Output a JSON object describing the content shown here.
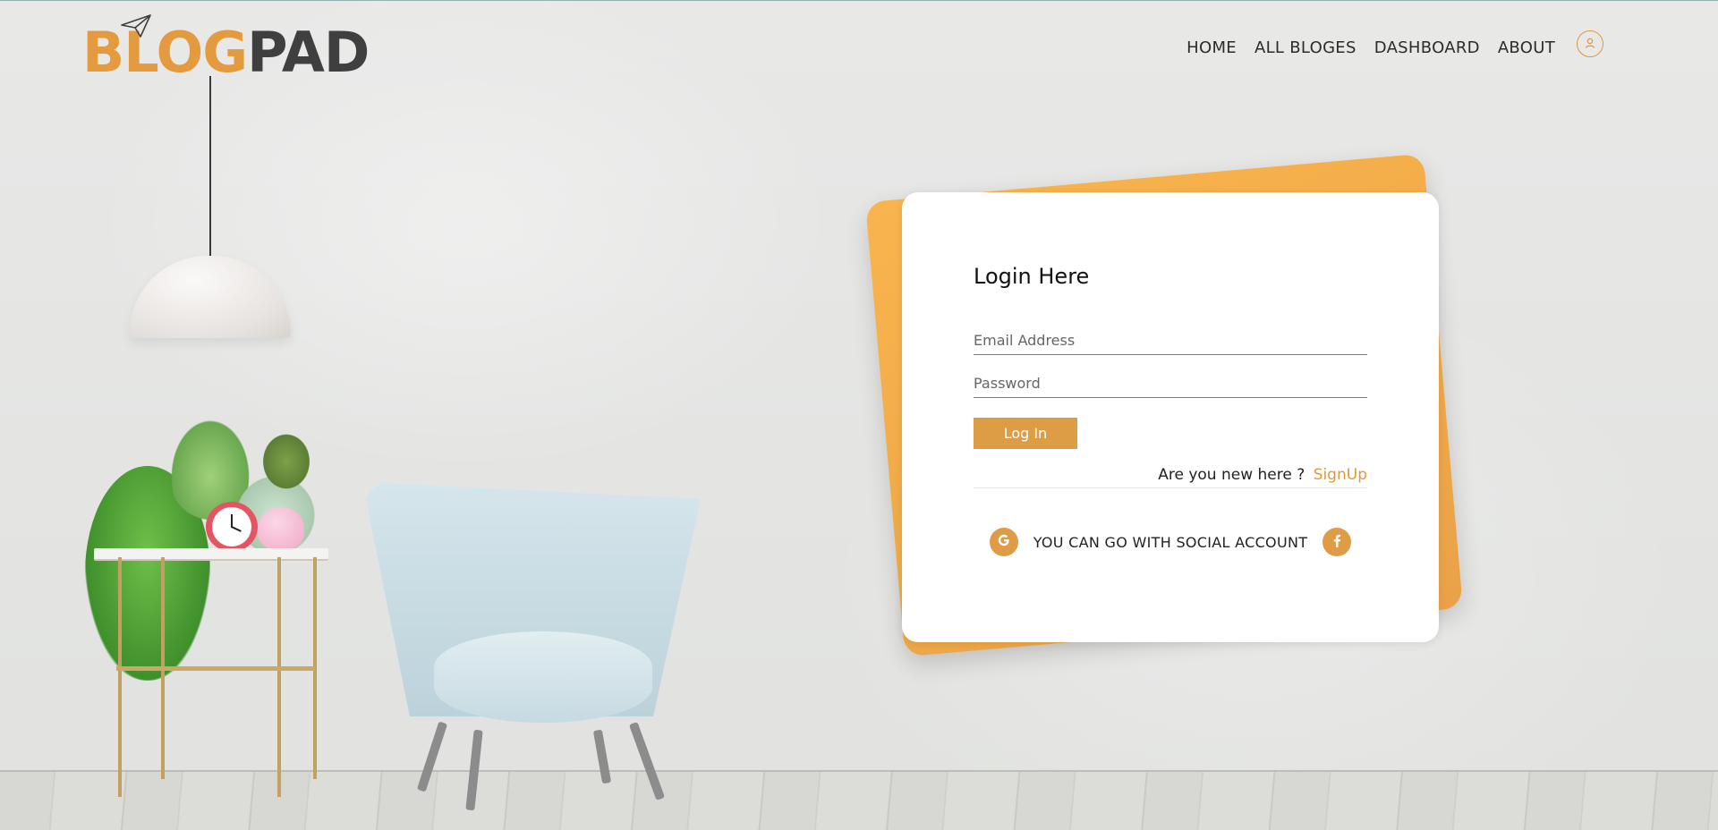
{
  "brand": {
    "logo_part1": "BLOG",
    "logo_part2": "PAD",
    "logo_icon": "paper-plane-icon"
  },
  "nav": {
    "items": [
      {
        "label": "HOME"
      },
      {
        "label": "ALL BLOGES"
      },
      {
        "label": "DASHBOARD"
      },
      {
        "label": "ABOUT"
      }
    ],
    "user_icon": "user-icon"
  },
  "login": {
    "title": "Login Here",
    "email_placeholder": "Email Address",
    "email_value": "",
    "password_placeholder": "Password",
    "password_value": "",
    "submit_label": "Log In",
    "new_here_text": "Are you new here ?",
    "signup_label": "SignUp",
    "social_text": "YOU CAN GO WITH SOCIAL ACCOUNT",
    "social_icons": [
      "google-icon",
      "facebook-icon"
    ]
  },
  "colors": {
    "accent": "#e2973d",
    "button": "#dc9d45",
    "card_back": "#f2aa48",
    "logo_dark": "#3f3f3f"
  }
}
